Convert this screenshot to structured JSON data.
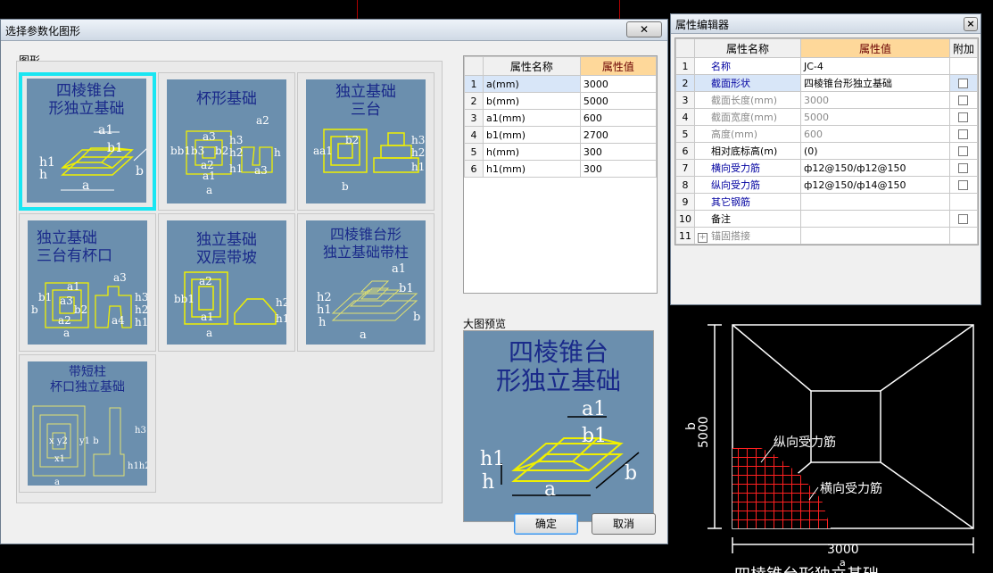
{
  "dialog": {
    "title": "选择参数化图形",
    "close_label": "✕",
    "group_label": "图形",
    "shapes": [
      {
        "label": "四棱锥台\n形独立基础"
      },
      {
        "label": "杯形基础"
      },
      {
        "label": "独立基础\n三台"
      },
      {
        "label": "独立基础\n三台有杯口"
      },
      {
        "label": "独立基础\n双层带坡"
      },
      {
        "label": "四棱锥台形\n独立基础带柱"
      },
      {
        "label": "带短柱\n杯口独立基础"
      }
    ],
    "thumb_dims": {
      "s1": [
        "a1",
        "b1",
        "h1",
        "h",
        "a",
        "b"
      ],
      "s2": [
        "a3",
        "a2",
        "b b1b3",
        "b2",
        "h3",
        "h2",
        "h1",
        "h",
        "a2",
        "a1",
        "a",
        "a3"
      ]
    },
    "params": {
      "header_name": "属性名称",
      "header_value": "属性值",
      "rows": [
        {
          "num": "1",
          "name": "a(mm)",
          "value": "3000"
        },
        {
          "num": "2",
          "name": "b(mm)",
          "value": "5000"
        },
        {
          "num": "3",
          "name": "a1(mm)",
          "value": "600"
        },
        {
          "num": "4",
          "name": "b1(mm)",
          "value": "2700"
        },
        {
          "num": "5",
          "name": "h(mm)",
          "value": "300"
        },
        {
          "num": "6",
          "name": "h1(mm)",
          "value": "300"
        }
      ]
    },
    "preview_label": "大图预览",
    "preview_title": "四棱锥台\n形独立基础",
    "ok_label": "确定",
    "cancel_label": "取消"
  },
  "editor": {
    "title": "属性编辑器",
    "close_label": "×",
    "header_name": "属性名称",
    "header_value": "属性值",
    "header_extra": "附加",
    "rows": [
      {
        "num": "1",
        "name": "名称",
        "value": "JC-4",
        "checkbox": false
      },
      {
        "num": "2",
        "name": "截面形状",
        "value": "四棱锥台形独立基础",
        "checkbox": true
      },
      {
        "num": "3",
        "name": "截面长度(mm)",
        "value": "3000",
        "checkbox": true
      },
      {
        "num": "4",
        "name": "截面宽度(mm)",
        "value": "5000",
        "checkbox": true
      },
      {
        "num": "5",
        "name": "高度(mm)",
        "value": "600",
        "checkbox": true
      },
      {
        "num": "6",
        "name": "相对底标高(m)",
        "value": "(0)",
        "checkbox": true
      },
      {
        "num": "7",
        "name": "横向受力筋",
        "value": "ф12@150/ф12@150",
        "checkbox": true
      },
      {
        "num": "8",
        "name": "纵向受力筋",
        "value": "ф12@150/ф14@150",
        "checkbox": true
      },
      {
        "num": "9",
        "name": "其它钢筋",
        "value": "",
        "checkbox": false
      },
      {
        "num": "10",
        "name": "备注",
        "value": "",
        "checkbox": true
      },
      {
        "num": "11",
        "name": "锚固搭接",
        "value": "",
        "checkbox": false
      }
    ]
  },
  "cad": {
    "dim_b": "b",
    "dim_b_value": "5000",
    "dim_a": "a",
    "dim_a_value": "3000",
    "label_long": "纵向受力筋",
    "label_trans": "横向受力筋",
    "footer_text": "四棱锥台形独立基础"
  },
  "colors": {
    "thumb_bg": "#6b8fae",
    "selection": "#19e6f2",
    "shape_line": "#f0f000",
    "rebar": "#ff0000"
  }
}
